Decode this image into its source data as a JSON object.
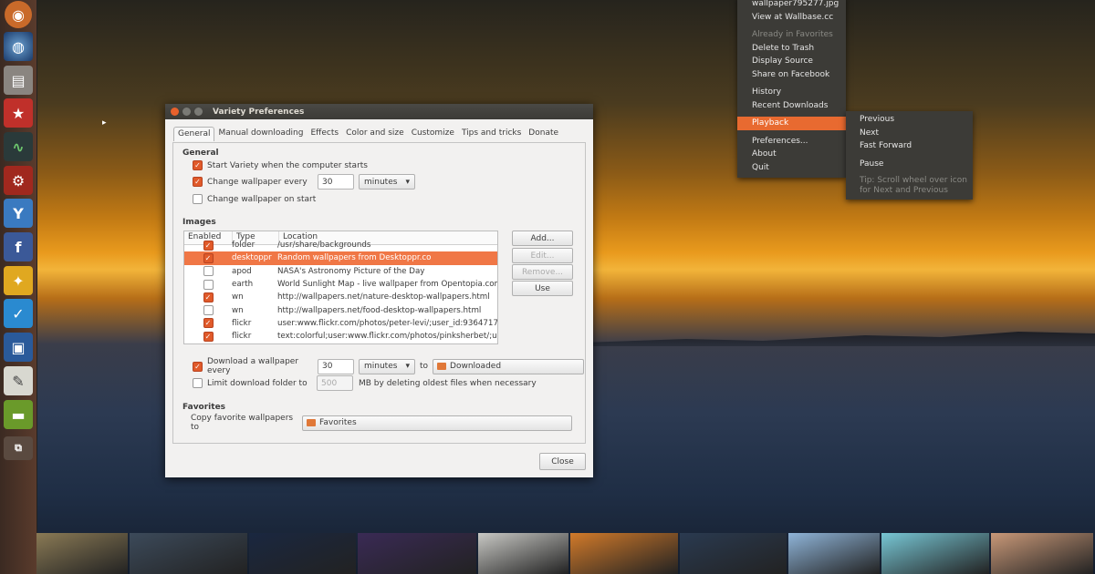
{
  "dialog": {
    "title": "Variety Preferences",
    "tabs": [
      "General",
      "Manual downloading",
      "Effects",
      "Color and size",
      "Customize",
      "Tips and tricks",
      "Donate"
    ],
    "general_heading": "General",
    "start_on_login": {
      "label": "Start Variety when the computer starts",
      "checked": true
    },
    "change_every": {
      "label": "Change wallpaper every",
      "checked": true,
      "value": "30",
      "unit": "minutes"
    },
    "change_on_start": {
      "label": "Change wallpaper on start",
      "checked": false
    },
    "images_heading": "Images",
    "table": {
      "columns": [
        "Enabled",
        "Type",
        "Location"
      ],
      "rows": [
        {
          "enabled": true,
          "type": "folder",
          "location": "/usr/share/backgrounds"
        },
        {
          "enabled": true,
          "type": "desktoppr",
          "location": "Random wallpapers from Desktoppr.co",
          "selected": true
        },
        {
          "enabled": false,
          "type": "apod",
          "location": "NASA's Astronomy Picture of the Day"
        },
        {
          "enabled": false,
          "type": "earth",
          "location": "World Sunlight Map - live wallpaper from Opentopia.com"
        },
        {
          "enabled": true,
          "type": "wn",
          "location": "http://wallpapers.net/nature-desktop-wallpapers.html"
        },
        {
          "enabled": false,
          "type": "wn",
          "location": "http://wallpapers.net/food-desktop-wallpapers.html"
        },
        {
          "enabled": true,
          "type": "flickr",
          "location": "user:www.flickr.com/photos/peter-levi/;user_id:93647178"
        },
        {
          "enabled": true,
          "type": "flickr",
          "location": "text:colorful;user:www.flickr.com/photos/pinksherbet/;u"
        }
      ]
    },
    "side_buttons": {
      "add": "Add...",
      "edit": "Edit...",
      "remove": "Remove...",
      "use": "Use"
    },
    "download_every": {
      "label": "Download a wallpaper every",
      "checked": true,
      "value": "30",
      "unit": "minutes",
      "to": "to",
      "folder": "Downloaded"
    },
    "limit": {
      "label": "Limit download folder to",
      "checked": false,
      "value": "500",
      "suffix": "MB by deleting oldest files when necessary"
    },
    "favorites_heading": "Favorites",
    "favorites": {
      "label": "Copy favorite wallpapers to",
      "folder": "Favorites"
    },
    "close": "Close"
  },
  "menu": {
    "items": [
      {
        "label": "wallpaper795277.jpg",
        "dis": false
      },
      {
        "label": "View at Wallbase.cc",
        "dis": false
      },
      {
        "sep": true
      },
      {
        "label": "Already in Favorites",
        "dis": true
      },
      {
        "label": "Delete to Trash",
        "dis": false
      },
      {
        "label": "Display Source",
        "dis": false
      },
      {
        "label": "Share on Facebook",
        "dis": false
      },
      {
        "sep": true
      },
      {
        "label": "History",
        "dis": false
      },
      {
        "label": "Recent Downloads",
        "dis": false
      },
      {
        "sep": true
      },
      {
        "label": "Playback",
        "hl": true
      },
      {
        "sep": true
      },
      {
        "label": "Preferences...",
        "dis": false
      },
      {
        "label": "About",
        "dis": false
      },
      {
        "label": "Quit",
        "dis": false
      }
    ]
  },
  "submenu": {
    "previous": "Previous",
    "next": "Next",
    "fast_forward": "Fast Forward",
    "pause": "Pause",
    "tip1": "Tip: Scroll wheel over icon",
    "tip2": "for Next and Previous"
  },
  "launcher_icons": [
    "ubuntu-icon",
    "browser-icon",
    "files-icon",
    "software-center-icon",
    "system-monitor-icon",
    "settings-icon",
    "yppa-icon",
    "facebook-icon",
    "idea-icon",
    "mail-icon",
    "virtualbox-icon",
    "text-editor-icon",
    "remote-desktop-icon",
    "workspaces-icon"
  ],
  "thumb_colors": [
    "#8a7a55",
    "#3c4a5a",
    "#1a2740",
    "#3a2a55",
    "#c8c8c4",
    "#d17a2a",
    "#2a3a50",
    "#8fb4d8",
    "#77c6d4",
    "#c89878"
  ]
}
